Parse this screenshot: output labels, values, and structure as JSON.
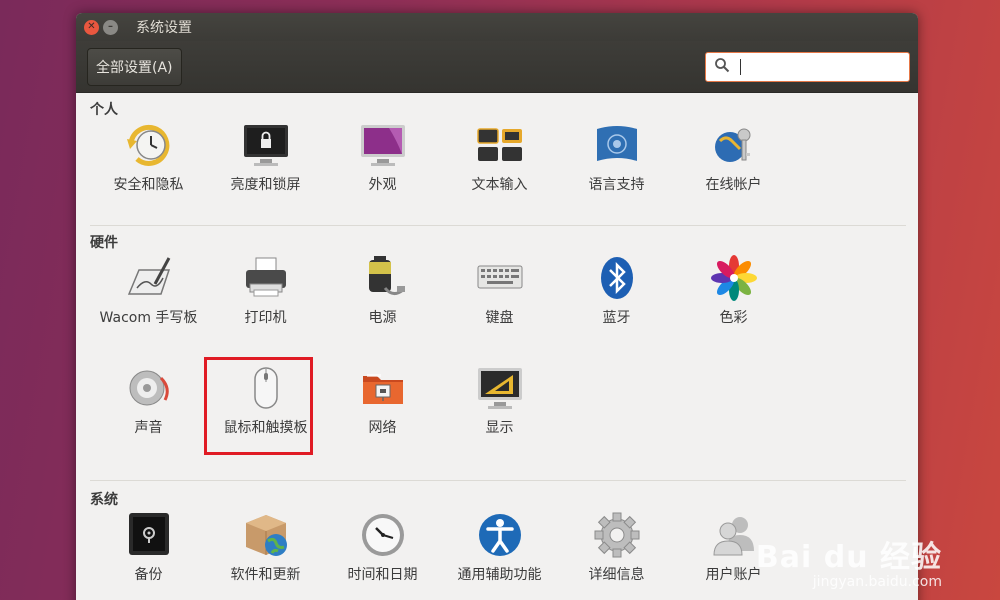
{
  "window": {
    "title": "系统设置"
  },
  "toolbar": {
    "all_settings": "全部设置(A)",
    "search_placeholder": ""
  },
  "sections": {
    "personal": {
      "title": "个人",
      "items": [
        "安全和隐私",
        "亮度和锁屏",
        "外观",
        "文本输入",
        "语言支持",
        "在线帐户"
      ]
    },
    "hardware": {
      "title": "硬件",
      "items": [
        "Wacom 手写板",
        "打印机",
        "电源",
        "键盘",
        "蓝牙",
        "色彩",
        "声音",
        "鼠标和触摸板",
        "网络",
        "显示"
      ]
    },
    "system": {
      "title": "系统",
      "items": [
        "备份",
        "软件和更新",
        "时间和日期",
        "通用辅助功能",
        "详细信息",
        "用户账户"
      ]
    }
  },
  "watermark": {
    "logo": "Bai du 经验",
    "url": "jingyan.baidu.com"
  },
  "colors": {
    "accent": "#e67847",
    "highlight": "#e01b24",
    "close": "#e9573f"
  }
}
